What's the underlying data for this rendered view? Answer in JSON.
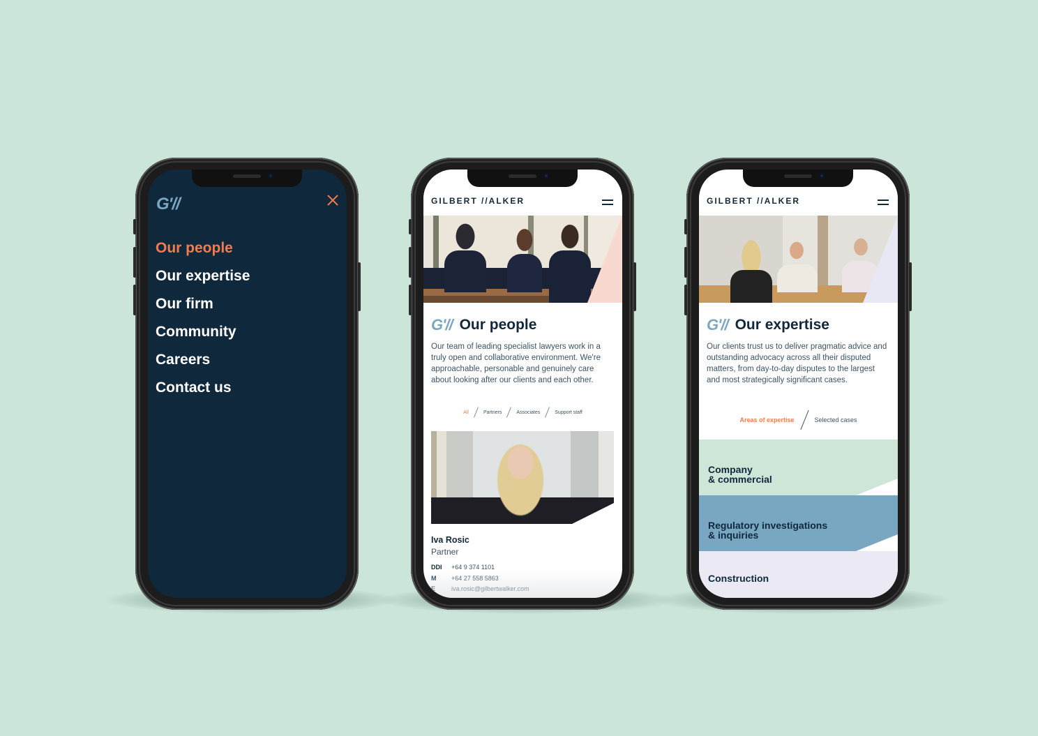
{
  "colors": {
    "background": "#cbe6d9",
    "navy": "#0f283c",
    "accent": "#f07c50",
    "logo_blue": "#7ba7c2",
    "area_green": "#cde6d8",
    "area_blue": "#79a7c1",
    "area_lavender": "#ebeaf4",
    "hero_tri_pink": "#f7d9cf",
    "hero_tri_lavender": "#e8e8f4"
  },
  "icons": {
    "logo_mark": "G'//",
    "close": "close-icon",
    "menu": "hamburger-icon"
  },
  "menu_screen": {
    "logo": "G'//",
    "items": [
      {
        "label": "Our people",
        "active": true
      },
      {
        "label": "Our expertise",
        "active": false
      },
      {
        "label": "Our firm",
        "active": false
      },
      {
        "label": "Community",
        "active": false
      },
      {
        "label": "Careers",
        "active": false
      },
      {
        "label": "Contact us",
        "active": false
      }
    ]
  },
  "people_screen": {
    "brand": "GILBERT //ALKER",
    "logo": "G'//",
    "title": "Our people",
    "intro": "Our team of leading specialist lawyers work in a truly open and collaborative environment. We're approachable, personable and genuinely care about looking after our clients and each other.",
    "filters": [
      {
        "label": "All",
        "active": true
      },
      {
        "label": "Partners",
        "active": false
      },
      {
        "label": "Associates",
        "active": false
      },
      {
        "label": "Support staff",
        "active": false
      }
    ],
    "person": {
      "name": "Iva Rosic",
      "role": "Partner",
      "contacts": [
        {
          "label": "DDI",
          "value": "+64 9 374 1101"
        },
        {
          "label": "M",
          "value": "+64 27 558 5863"
        },
        {
          "label": "E",
          "value": "iva.rosic@gilbertwalker.com"
        }
      ]
    }
  },
  "expertise_screen": {
    "brand": "GILBERT //ALKER",
    "logo": "G'//",
    "title": "Our expertise",
    "intro": "Our clients trust us to deliver pragmatic advice and outstanding advocacy across all their disputed matters, from day-to-day disputes to the largest and most strategically significant cases.",
    "tabs": [
      {
        "label": "Areas of expertise",
        "active": true
      },
      {
        "label": "Selected cases",
        "active": false
      }
    ],
    "areas": [
      {
        "line1": "Company",
        "line2": "& commercial"
      },
      {
        "line1": "Regulatory investigations",
        "line2": "& inquiries"
      },
      {
        "line1": "Construction",
        "line2": ""
      }
    ]
  }
}
